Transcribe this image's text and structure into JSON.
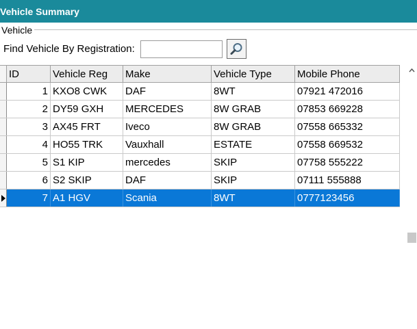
{
  "window": {
    "title": "Vehicle Summary"
  },
  "group": {
    "label": "Vehicle"
  },
  "search": {
    "label": "Find Vehicle By Registration:",
    "value": "",
    "button_icon": "magnifier-icon"
  },
  "table": {
    "columns": [
      "ID",
      "Vehicle Reg",
      "Make",
      "Vehicle Type",
      "Mobile Phone"
    ],
    "rows": [
      [
        "1",
        "KXO8 CWK",
        "DAF",
        "8WT",
        "07921 472016"
      ],
      [
        "2",
        "DY59 GXH",
        "MERCEDES",
        "8W GRAB",
        "07853 669228"
      ],
      [
        "3",
        "AX45 FRT",
        "Iveco",
        "8W GRAB",
        "07558 665332"
      ],
      [
        "4",
        "HO55 TRK",
        "Vauxhall",
        "ESTATE",
        "07558 669532"
      ],
      [
        "5",
        "S1 KIP",
        "mercedes",
        "SKIP",
        "07758 555222"
      ],
      [
        "6",
        "S2 SKIP",
        "DAF",
        "SKIP",
        "07111 555888"
      ],
      [
        "7",
        "A1 HGV",
        "Scania",
        "8WT",
        "0777123456"
      ]
    ],
    "selected_row_index": 6
  },
  "colors": {
    "title_bar": "#1a8a9b",
    "selection": "#0a78d7"
  }
}
